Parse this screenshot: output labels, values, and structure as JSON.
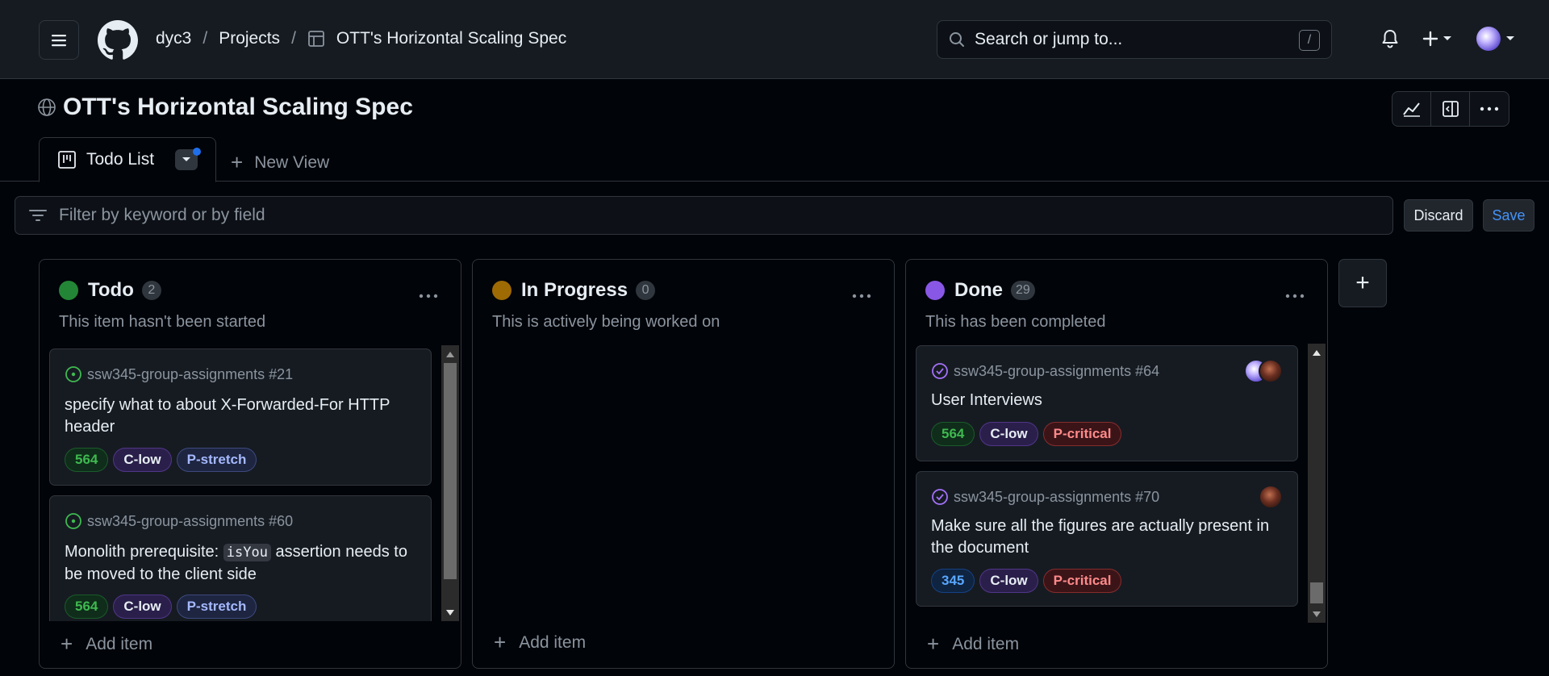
{
  "header": {
    "breadcrumb": [
      "dyc3",
      "Projects",
      "OTT's Horizontal Scaling Spec"
    ],
    "separator": "/",
    "search_placeholder": "Search or jump to...",
    "search_shortcut": "/",
    "icons": [
      "menu-icon",
      "github-logo-icon",
      "bell-icon",
      "plus-icon",
      "avatar"
    ]
  },
  "project": {
    "title": "OTT's Horizontal Scaling Spec",
    "actions": [
      "insights-icon",
      "side-panel-icon",
      "more-icon"
    ]
  },
  "tabs": [
    {
      "label": "Todo List",
      "active": true,
      "unsaved": true
    },
    {
      "label": "New View",
      "active": false
    }
  ],
  "filter": {
    "placeholder": "Filter by keyword or by field",
    "discard_label": "Discard",
    "save_label": "Save"
  },
  "columns": [
    {
      "name": "Todo",
      "count": "2",
      "color": "#238636",
      "description": "This item hasn't been started",
      "add_label": "Add item",
      "cards": [
        {
          "ref": "ssw345-group-assignments #21",
          "title": "specify what to about X-Forwarded-For HTTP header",
          "labels": [
            "564",
            "C-low",
            "P-stretch"
          ]
        },
        {
          "ref": "ssw345-group-assignments #60",
          "title_pre": "Monolith prerequisite: ",
          "title_code": "isYou",
          "title_post": " assertion needs to be moved to the client side",
          "labels": [
            "564",
            "C-low",
            "P-stretch"
          ]
        }
      ]
    },
    {
      "name": "In Progress",
      "count": "0",
      "color": "#9e6a03",
      "description": "This is actively being worked on",
      "add_label": "Add item",
      "cards": []
    },
    {
      "name": "Done",
      "count": "29",
      "color": "#8957e5",
      "description": "This has been completed",
      "add_label": "Add item",
      "cards": [
        {
          "ref": "ssw345-group-assignments #64",
          "title": "User Interviews",
          "labels": [
            "564",
            "C-low",
            "P-critical"
          ]
        },
        {
          "ref": "ssw345-group-assignments #70",
          "title": "Make sure all the figures are actually present in the document",
          "labels": [
            "345",
            "C-low",
            "P-critical"
          ]
        }
      ]
    }
  ],
  "add_column_label": "+"
}
